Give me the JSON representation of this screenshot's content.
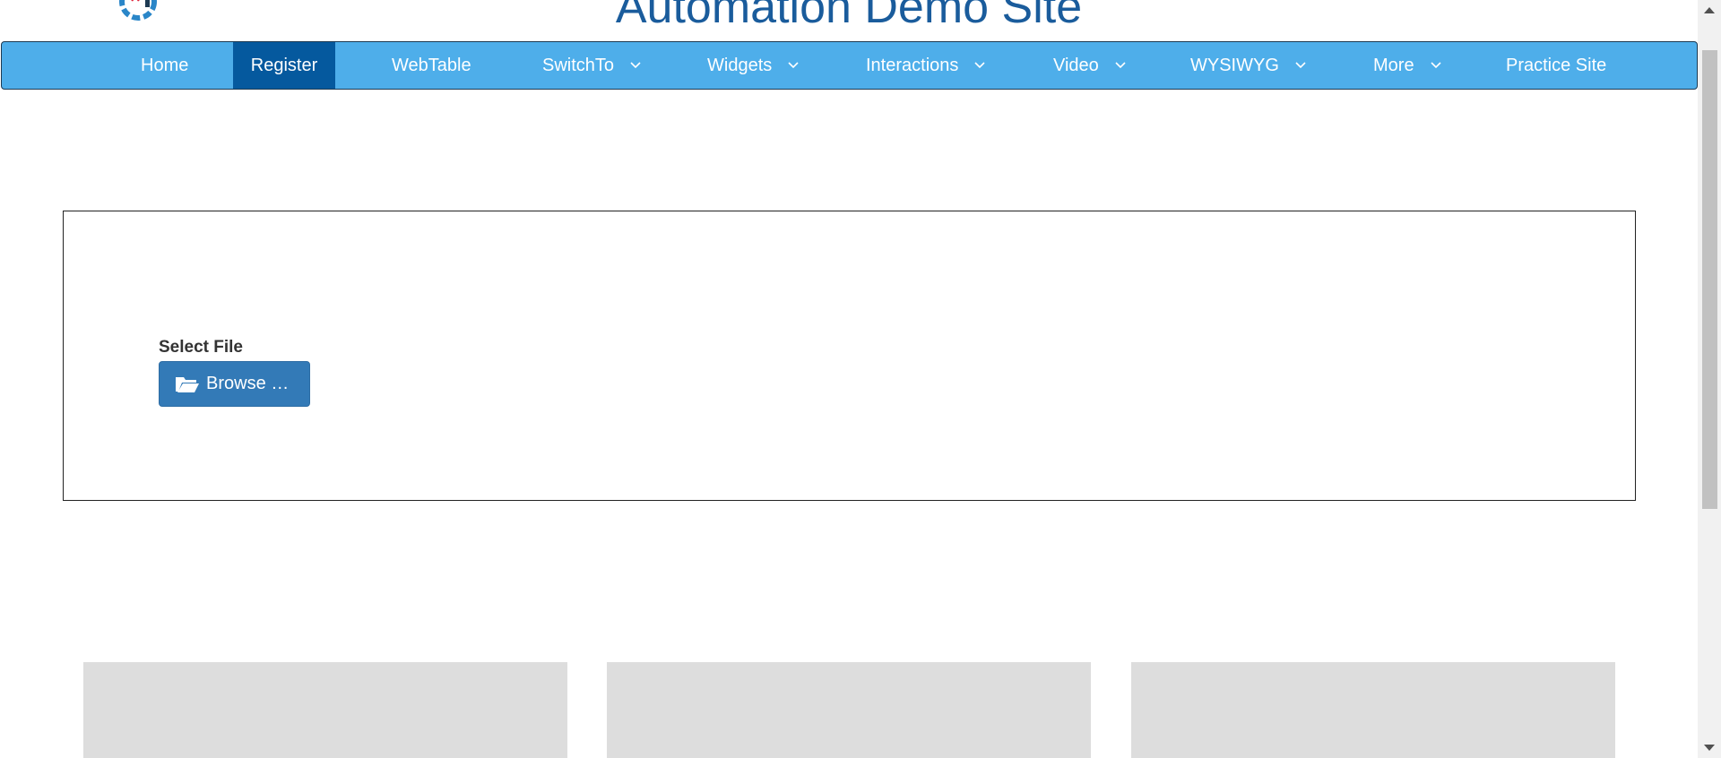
{
  "header": {
    "title": "Automation Demo Site",
    "logo_icon": "gear-logo-icon"
  },
  "nav": {
    "items": [
      {
        "label": "Home",
        "dropdown": false,
        "active": false
      },
      {
        "label": "Register",
        "dropdown": false,
        "active": true
      },
      {
        "label": "WebTable",
        "dropdown": false,
        "active": false
      },
      {
        "label": "SwitchTo",
        "dropdown": true,
        "active": false
      },
      {
        "label": "Widgets",
        "dropdown": true,
        "active": false
      },
      {
        "label": "Interactions",
        "dropdown": true,
        "active": false
      },
      {
        "label": "Video",
        "dropdown": true,
        "active": false
      },
      {
        "label": "WYSIWYG",
        "dropdown": true,
        "active": false
      },
      {
        "label": "More",
        "dropdown": true,
        "active": false
      },
      {
        "label": "Practice Site",
        "dropdown": false,
        "active": false
      }
    ]
  },
  "upload": {
    "label": "Select File",
    "button_label": "Browse …",
    "button_icon": "folder-open-icon"
  },
  "colors": {
    "nav_bg": "#4eaeea",
    "nav_active": "#05599e",
    "title": "#1a5c9c",
    "button": "#337ab7",
    "card": "#dddddd"
  }
}
